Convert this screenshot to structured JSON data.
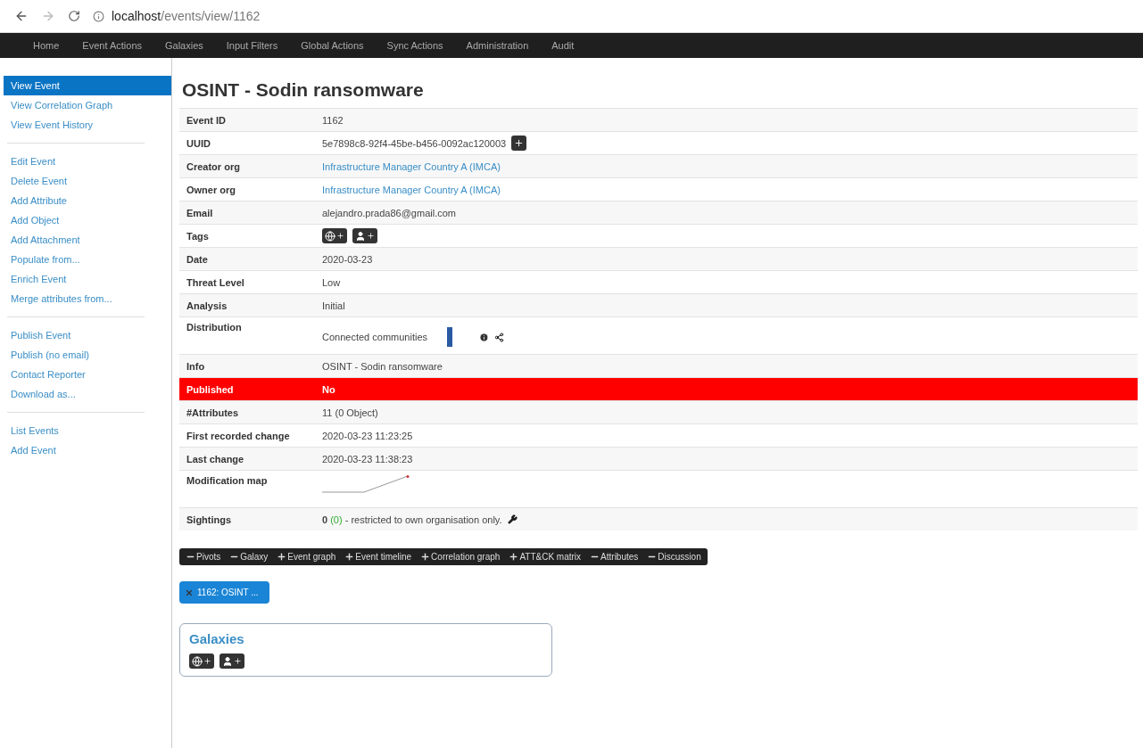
{
  "browser": {
    "url_host": "localhost",
    "url_path": "/events/view/1162"
  },
  "nav": [
    "Home",
    "Event Actions",
    "Galaxies",
    "Input Filters",
    "Global Actions",
    "Sync Actions",
    "Administration",
    "Audit"
  ],
  "sidebar": {
    "groups": [
      [
        {
          "label": "View Event",
          "selected": true
        },
        {
          "label": "View Correlation Graph",
          "selected": false
        },
        {
          "label": "View Event History",
          "selected": false
        }
      ],
      [
        {
          "label": "Edit Event",
          "selected": false
        },
        {
          "label": "Delete Event",
          "selected": false
        },
        {
          "label": "Add Attribute",
          "selected": false
        },
        {
          "label": "Add Object",
          "selected": false
        },
        {
          "label": "Add Attachment",
          "selected": false
        },
        {
          "label": "Populate from...",
          "selected": false
        },
        {
          "label": "Enrich Event",
          "selected": false
        },
        {
          "label": "Merge attributes from...",
          "selected": false
        }
      ],
      [
        {
          "label": "Publish Event",
          "selected": false
        },
        {
          "label": "Publish (no email)",
          "selected": false
        },
        {
          "label": "Contact Reporter",
          "selected": false
        },
        {
          "label": "Download as...",
          "selected": false
        }
      ],
      [
        {
          "label": "List Events",
          "selected": false
        },
        {
          "label": "Add Event",
          "selected": false
        }
      ]
    ]
  },
  "title": "OSINT - Sodin ransomware",
  "rows": [
    {
      "kind": "text",
      "label": "Event ID",
      "value": "1162"
    },
    {
      "kind": "uuid",
      "label": "UUID",
      "value": "5e7898c8-92f4-45be-b456-0092ac120003"
    },
    {
      "kind": "link",
      "label": "Creator org",
      "value": "Infrastructure Manager Country A (IMCA)"
    },
    {
      "kind": "link",
      "label": "Owner org",
      "value": "Infrastructure Manager Country A (IMCA)"
    },
    {
      "kind": "text",
      "label": "Email",
      "value": "alejandro.prada86@gmail.com"
    },
    {
      "kind": "tags",
      "label": "Tags"
    },
    {
      "kind": "text",
      "label": "Date",
      "value": "2020-03-23"
    },
    {
      "kind": "text",
      "label": "Threat Level",
      "value": "Low"
    },
    {
      "kind": "text",
      "label": "Analysis",
      "value": "Initial"
    },
    {
      "kind": "distribution",
      "label": "Distribution",
      "value": "Connected communities"
    },
    {
      "kind": "text",
      "label": "Info",
      "value": "OSINT - Sodin ransomware"
    },
    {
      "kind": "alert",
      "label": "Published",
      "value": "No"
    },
    {
      "kind": "text",
      "label": "#Attributes",
      "value": "11 (0 Object)"
    },
    {
      "kind": "text",
      "label": "First recorded change",
      "value": "2020-03-23 11:23:25"
    },
    {
      "kind": "text",
      "label": "Last change",
      "value": "2020-03-23 11:38:23"
    },
    {
      "kind": "map",
      "label": "Modification map"
    },
    {
      "kind": "sightings",
      "label": "Sightings",
      "count": "0",
      "own": "(0)",
      "note": " - restricted to own organisation only."
    }
  ],
  "toggles": [
    {
      "label": "Pivots",
      "expanded": true
    },
    {
      "label": "Galaxy",
      "expanded": true
    },
    {
      "label": "Event graph",
      "expanded": false
    },
    {
      "label": "Event timeline",
      "expanded": false
    },
    {
      "label": "Correlation graph",
      "expanded": false
    },
    {
      "label": "ATT&CK matrix",
      "expanded": false
    },
    {
      "label": "Attributes",
      "expanded": true
    },
    {
      "label": "Discussion",
      "expanded": true
    }
  ],
  "pivot": "1162: OSINT ...",
  "galaxies": {
    "title": "Galaxies"
  }
}
